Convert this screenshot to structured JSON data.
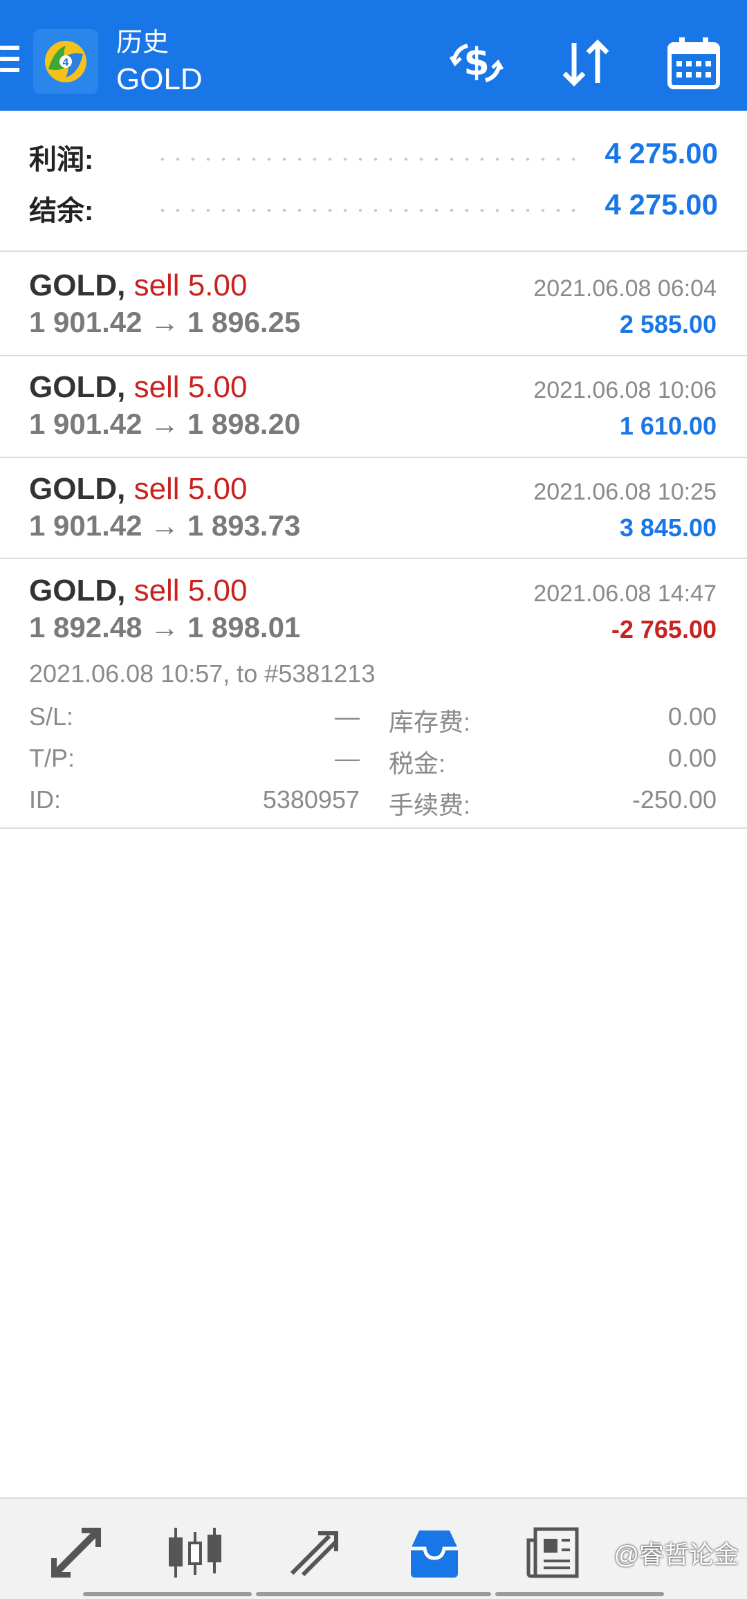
{
  "header": {
    "title": "历史",
    "subtitle": "GOLD",
    "menu_icon": "hamburger-icon",
    "logo_icon": "metatrader-logo",
    "actions": [
      "exchange-dollar-icon",
      "sort-icon",
      "calendar-icon"
    ]
  },
  "summary": {
    "profit_label": "利润:",
    "profit_value": "4 275.00",
    "balance_label": "结余:",
    "balance_value": "4 275.00"
  },
  "trades": [
    {
      "symbol": "GOLD,",
      "side": "sell 5.00",
      "prices": "1 901.42 → 1 896.25",
      "time": "2021.06.08 06:04",
      "profit": "2 585.00"
    },
    {
      "symbol": "GOLD,",
      "side": "sell 5.00",
      "prices": "1 901.42 → 1 898.20",
      "time": "2021.06.08 10:06",
      "profit": "1 610.00"
    },
    {
      "symbol": "GOLD,",
      "side": "sell 5.00",
      "prices": "1 901.42 → 1 893.73",
      "time": "2021.06.08 10:25",
      "profit": "3 845.00"
    },
    {
      "symbol": "GOLD,",
      "side": "sell 5.00",
      "prices": "1 892.48 → 1 898.01",
      "time": "2021.06.08 14:47",
      "profit": "-2 765.00"
    }
  ],
  "detail": {
    "open_info": "2021.06.08 10:57, to #5381213",
    "sl_label": "S/L:",
    "sl_value": "—",
    "tp_label": "T/P:",
    "tp_value": "—",
    "id_label": "ID:",
    "id_value": "5380957",
    "swap_label": "库存费:",
    "swap_value": "0.00",
    "tax_label": "税金:",
    "tax_value": "0.00",
    "fee_label": "手续费:",
    "fee_value": "-250.00"
  },
  "bottom_nav": {
    "items": [
      "quotes-icon",
      "chart-icon",
      "trade-icon",
      "history-icon",
      "news-icon"
    ],
    "active": "history-icon",
    "watermark": "@睿哲论金"
  },
  "colors": {
    "header_bg": "#1976e6",
    "positive": "#1976e6",
    "negative": "#c9211e"
  }
}
